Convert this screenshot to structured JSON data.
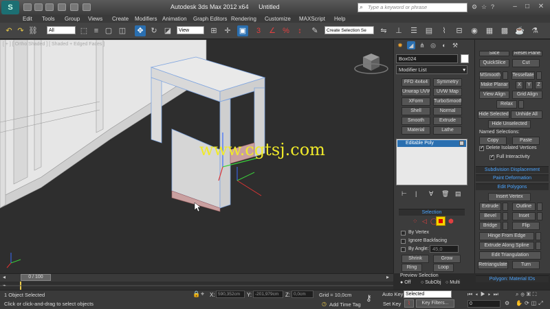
{
  "window": {
    "app_logo": "S",
    "title": "Autodesk 3ds Max  2012 x64",
    "document": "Untitled",
    "search_placeholder": "Type a keyword or phrase",
    "minimize": "–",
    "maximize": "□",
    "close": "✕"
  },
  "menu": [
    "Edit",
    "Tools",
    "Group",
    "Views",
    "Create",
    "Modifiers",
    "Animation",
    "Graph Editors",
    "Rendering",
    "Customize",
    "MAXScript",
    "Help"
  ],
  "toolbar": {
    "selection_filter": "All",
    "reference_coord": "View",
    "named_selection_set": "Create Selection Se"
  },
  "viewport": {
    "label": "[ + ] [ Ortho Shaded ] [ Shaded + Edged Faces ]",
    "watermark": "www.cgtsj.com"
  },
  "command_panel": {
    "object_name": "Box024",
    "modifier_list": "Modifier List",
    "modifier_buttons": [
      "FFD 4x4x4",
      "Symmetry",
      "Unwrap UVW",
      "UVW Map",
      "XForm",
      "TurboSmooth",
      "Shell",
      "Normal",
      "Smooth",
      "Extrude",
      "Material",
      "Lathe"
    ],
    "stack_item": "Editable Poly",
    "selection": {
      "header": "Selection",
      "by_vertex": "By Vertex",
      "ignore_backfacing": "Ignore Backfacing",
      "by_angle": "By Angle:",
      "angle_value": "45,0",
      "shrink": "Shrink",
      "grow": "Grow",
      "ring": "Ring",
      "loop": "Loop",
      "preview_selection": "Preview Selection",
      "off": "Off",
      "subobj": "SubObj",
      "multi": "Multi"
    }
  },
  "rollout": {
    "top_partial_left": "Slice",
    "top_partial_right": "Reset Plane",
    "quickslice": "QuickSlice",
    "cut": "Cut",
    "msmooth": "MSmooth",
    "tessellate": "Tessellate",
    "make_planar": "Make Planar",
    "x": "X",
    "y": "Y",
    "z": "Z",
    "view_align": "View Align",
    "grid_align": "Grid Align",
    "relax": "Relax",
    "hide_selected": "Hide Selected",
    "unhide_all": "Unhide All",
    "hide_unselected": "Hide Unselected",
    "named_selections": "Named Selections:",
    "copy": "Copy",
    "paste": "Paste",
    "delete_isolated": "Delete Isolated Vertices",
    "full_interactivity": "Full Interactivity",
    "subdivision_displacement": "Subdivision Displacement",
    "paint_deformation": "Paint Deformation",
    "edit_polygons": "Edit Polygons",
    "insert_vertex": "Insert Vertex",
    "extrude": "Extrude",
    "outline": "Outline",
    "bevel": "Bevel",
    "inset": "Inset",
    "bridge": "Bridge",
    "flip": "Flip",
    "hinge_from_edge": "Hinge From Edge",
    "extrude_along_spline": "Extrude Along Spline",
    "edit_triangulation": "Edit Triangulation",
    "retriangulate": "Retriangulate",
    "turn": "Turn",
    "polygon_material_ids": "Polygon: Material IDs"
  },
  "timeline": {
    "frame": "0 / 100"
  },
  "status": {
    "selection_info": "1 Object Selected",
    "prompt": "Click or click-and-drag to select objects",
    "x_label": "X:",
    "x_value": "590,352cm",
    "y_label": "Y:",
    "y_value": "-201,979cm",
    "z_label": "Z:",
    "z_value": "0,0cm",
    "grid": "Grid = 10,0cm",
    "add_time_tag": "Add Time Tag",
    "auto_key": "Auto Key",
    "set_key": "Set Key",
    "key_mode": "Selected",
    "key_filters": "Key Filters...",
    "frame_field": "0"
  },
  "colors": {
    "accent_blue": "#4aa4ff",
    "watermark": "#f0ea2a",
    "selection_yellow": "#f5d400"
  }
}
